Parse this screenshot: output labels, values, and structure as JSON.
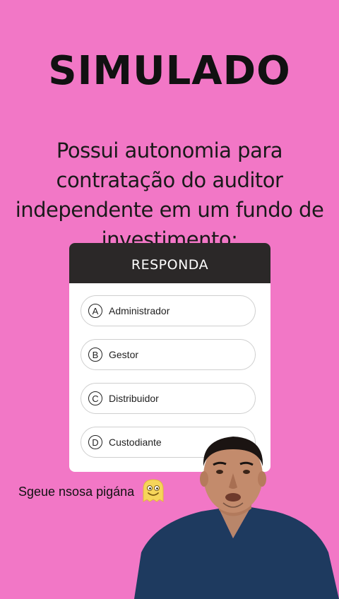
{
  "title": "SIMULADO",
  "question": "Possui autonomia para contratação do auditor independente em um fundo de investimento:",
  "quiz": {
    "header": "RESPONDA",
    "options": [
      {
        "letter": "A",
        "text": "Administrador"
      },
      {
        "letter": "B",
        "text": "Gestor"
      },
      {
        "letter": "C",
        "text": "Distribuidor"
      },
      {
        "letter": "D",
        "text": "Custodiante"
      }
    ]
  },
  "caption": {
    "text": "Sgeue nsosa pigána",
    "icon": "smiling-ghost-emoji"
  },
  "colors": {
    "background": "#f277c6",
    "header": "#2b2828",
    "shirt": "#1e3a5f"
  }
}
